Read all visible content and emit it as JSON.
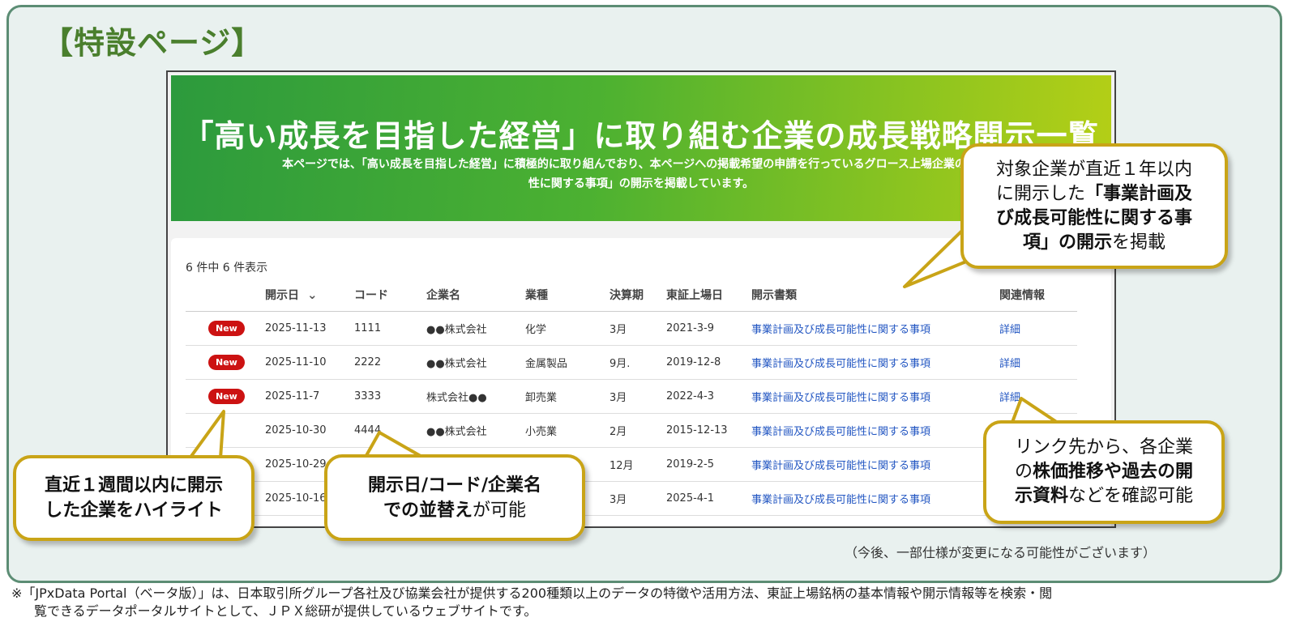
{
  "page_heading": "【特設ページ】",
  "hero": {
    "title": "「高い成長を目指した経営」に取り組む企業の成長戦略開示一覧",
    "description_line1": "本ページでは、「高い成長を目指した経営」に積極的に取り組んでおり、本ページへの掲載希望の申請を行っているグロース上場企業の「事業",
    "description_line2": "性に関する事項」の開示を掲載しています。"
  },
  "table": {
    "count_text": "6 件中 6 件表示",
    "headers": {
      "date": "開示日",
      "code": "コード",
      "company": "企業名",
      "industry": "業種",
      "fiscal": "決算期",
      "listed": "東証上場日",
      "document": "開示書類",
      "related": "関連情報"
    },
    "sort_icon": "chevron-down-icon",
    "rows": [
      {
        "new": "New",
        "date": "2025-11-13",
        "code": "1111",
        "company": "●●株式会社",
        "industry": "化学",
        "fiscal": "3月",
        "listed": "2021-3-9",
        "document": "事業計画及び成長可能性に関する事項",
        "related": "詳細"
      },
      {
        "new": "New",
        "date": "2025-11-10",
        "code": "2222",
        "company": "●●株式会社",
        "industry": "金属製品",
        "fiscal": "9月.",
        "listed": "2019-12-8",
        "document": "事業計画及び成長可能性に関する事項",
        "related": "詳細"
      },
      {
        "new": "New",
        "date": "2025-11-7",
        "code": "3333",
        "company": "株式会社●●",
        "industry": "卸売業",
        "fiscal": "3月",
        "listed": "2022-4-3",
        "document": "事業計画及び成長可能性に関する事項",
        "related": "詳細"
      },
      {
        "new": "",
        "date": "2025-10-30",
        "code": "4444",
        "company": "●●株式会社",
        "industry": "小売業",
        "fiscal": "2月",
        "listed": "2015-12-13",
        "document": "事業計画及び成長可能性に関する事項",
        "related": ""
      },
      {
        "new": "",
        "date": "2025-10-29",
        "code": "",
        "company": "",
        "industry": "",
        "fiscal": "12月",
        "listed": "2019-2-5",
        "document": "事業計画及び成長可能性に関する事項",
        "related": ""
      },
      {
        "new": "",
        "date": "2025-10-16",
        "code": "",
        "company": "",
        "industry": "",
        "fiscal": "3月",
        "listed": "2025-4-1",
        "document": "事業計画及び成長可能性に関する事項",
        "related": ""
      }
    ]
  },
  "callouts": {
    "top": {
      "line1": "対象企業が直近１年以内",
      "line2_plain": "に開示した",
      "line2_bold": "「事業計画及",
      "line3": "び成長可能性に関する事",
      "line4_bold": "項」の開示",
      "line4_plain": "を掲載"
    },
    "right": {
      "line1": "リンク先から、各企業",
      "line2_plain": "の",
      "line2_bold": "株価推移や過去の開",
      "line3_bold": "示資料",
      "line3_plain": "などを確認可能"
    },
    "left": {
      "line1": "直近１週間以内に開示",
      "line2": "した企業をハイライト"
    },
    "middle": {
      "line1": "開示日/コード/企業名",
      "line2_bold": "での並替え",
      "line2_plain": "が可能"
    }
  },
  "disclaimer": "（今後、一部仕様が変更になる可能性がございます）",
  "footnote": {
    "line1": "※「JPxData Portal（ベータ版）」は、日本取引所グループ各社及び協業会社が提供する200種類以上のデータの特徴や活用方法、東証上場銘柄の基本情報や開示情報等を検索・閲",
    "line2": "覧できるデータポータルサイトとして、ＪＰＸ総研が提供しているウェブサイトです。"
  },
  "colors": {
    "accent_green": "#4a7f2d",
    "callout_border": "#c9a417",
    "badge_red": "#cc1212",
    "link_blue": "#2256c2"
  }
}
